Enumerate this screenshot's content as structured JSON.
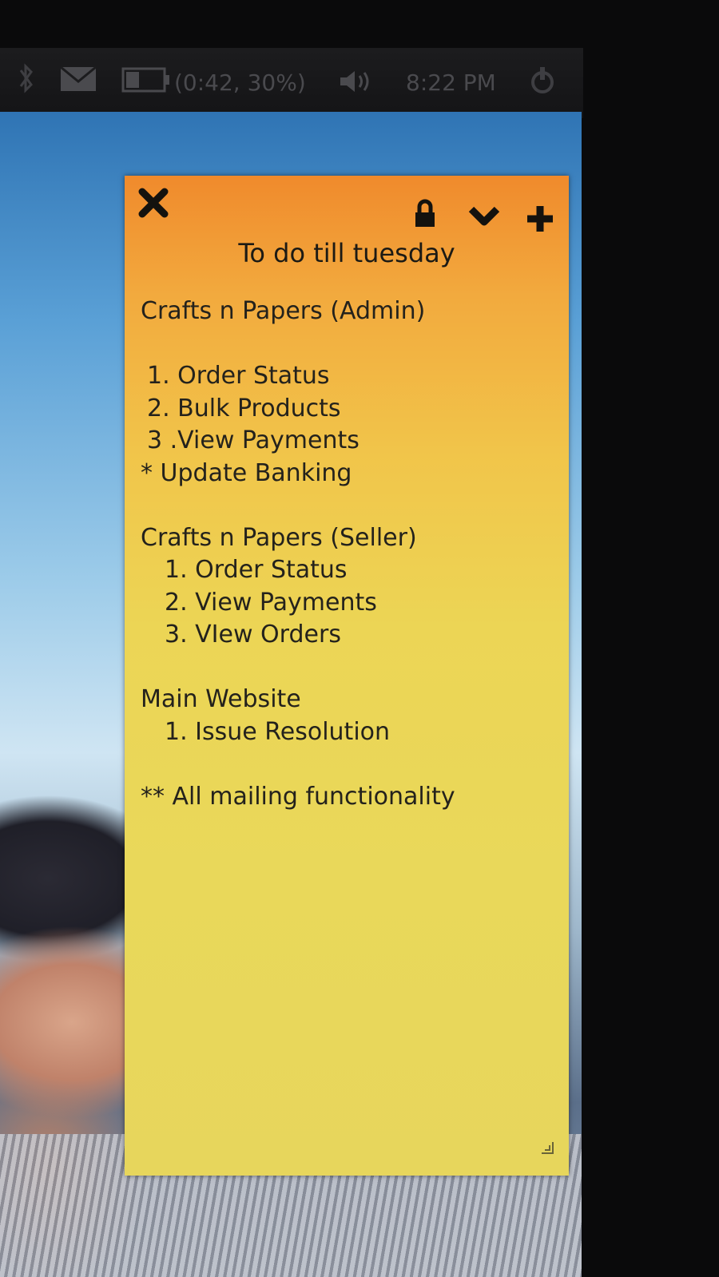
{
  "panel": {
    "battery_text": "(0:42, 30%)",
    "clock": "8:22 PM",
    "icons": [
      "bluetooth-icon",
      "mail-icon",
      "battery-icon",
      "volume-icon",
      "power-icon"
    ]
  },
  "note": {
    "toolbar": {
      "close_icon": "close-icon",
      "lock_icon": "lock-icon",
      "menu_icon": "chevron-down-icon",
      "add_icon": "plus-icon"
    },
    "title": "To do till tuesday",
    "lines": [
      "Crafts n Papers (Admin)",
      "",
      " 1. Order Status",
      " 2. Bulk Products",
      " 3 .View Payments",
      "* Update Banking",
      "",
      "Crafts n Papers (Seller)",
      "   1. Order Status",
      "   2. View Payments",
      "   3. VIew Orders",
      "",
      "Main Website",
      "   1. Issue Resolution",
      "",
      "** All mailing functionality"
    ],
    "colors": {
      "top": "#f08a2c",
      "bottom": "#e7d65c",
      "text": "#24221c"
    }
  }
}
